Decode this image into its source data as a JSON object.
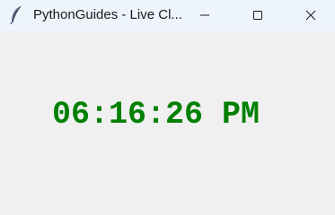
{
  "window": {
    "title": "PythonGuides - Live Cl...",
    "icon": "feather-icon",
    "controls": {
      "minimize_icon": "minimize-icon",
      "maximize_icon": "maximize-icon",
      "close_icon": "close-icon"
    }
  },
  "clock": {
    "time": "06:16:26 PM",
    "color": "#008000"
  },
  "colors": {
    "titlebar": "#eef4fb",
    "background": "#f0f0f0"
  }
}
